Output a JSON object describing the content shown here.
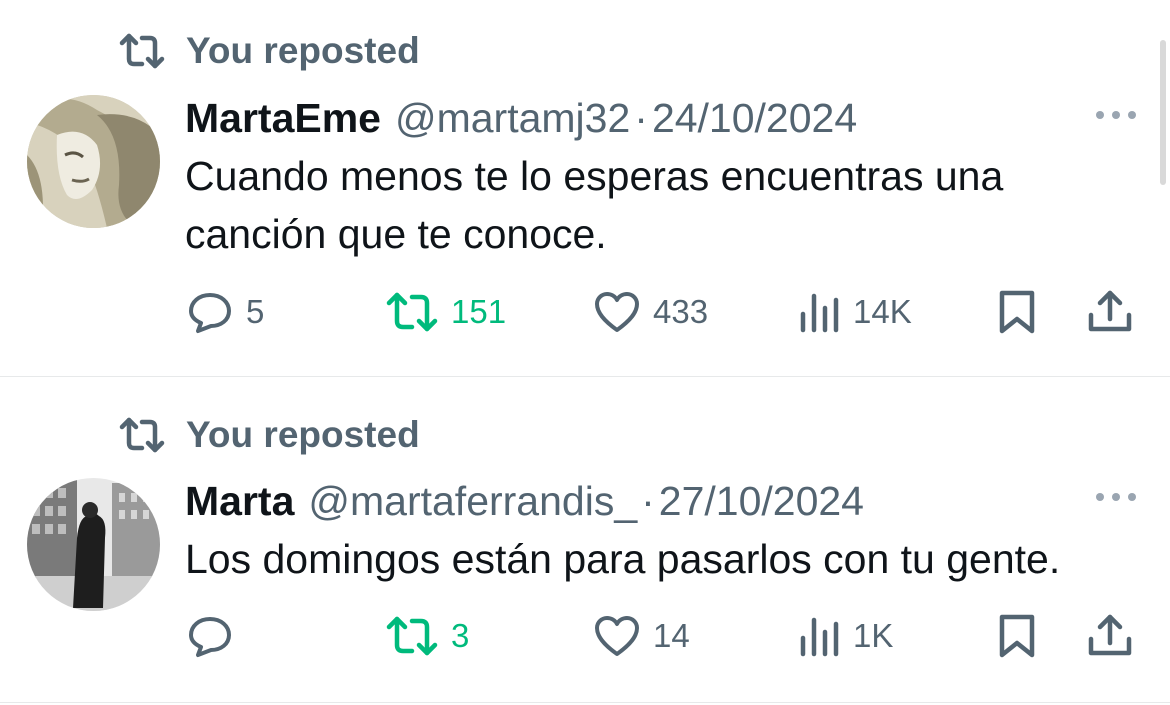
{
  "tweets": [
    {
      "social_context": "You reposted",
      "name": "MartaEme",
      "handle": "@martamj32",
      "separator": "·",
      "date": "24/10/2024",
      "text": "Cuando menos te lo esperas encuentras una canción que te conoce.",
      "reply_count": "5",
      "repost_count": "151",
      "like_count": "433",
      "view_count": "14K"
    },
    {
      "social_context": "You reposted",
      "name": "Marta",
      "handle": "@martaferrandis_",
      "separator": "·",
      "date": "27/10/2024",
      "text": "Los domingos están para pasarlos con tu gente.",
      "reply_count": "",
      "repost_count": "3",
      "like_count": "14",
      "view_count": "1K"
    }
  ],
  "colors": {
    "text_primary": "#0f1419",
    "text_secondary": "#536471",
    "repost_active": "#00ba7c",
    "divider": "#e7e9ea"
  },
  "icons": {
    "repost": "repost-icon",
    "reply": "reply-icon",
    "like": "heart-icon",
    "views": "views-icon",
    "bookmark": "bookmark-icon",
    "share": "share-icon",
    "more": "more-icon"
  }
}
